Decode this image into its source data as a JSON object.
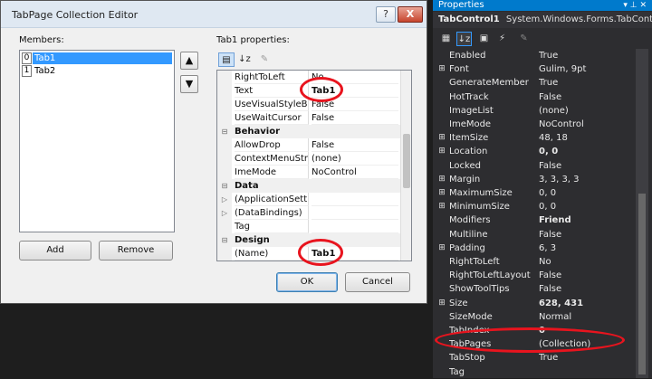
{
  "dialog": {
    "title": "TabPage Collection Editor",
    "help_label": "?",
    "close_label": "X",
    "members_label": "Members:",
    "members": [
      {
        "index": "0",
        "name": "Tab1",
        "selected": true
      },
      {
        "index": "1",
        "name": "Tab2",
        "selected": false
      }
    ],
    "up_label": "▲",
    "down_label": "▼",
    "add_label": "Add",
    "remove_label": "Remove",
    "props_label": "Tab1 properties:",
    "ok_label": "OK",
    "cancel_label": "Cancel",
    "grid_rows": [
      {
        "kind": "prop",
        "name": "RightToLeft",
        "value": "No"
      },
      {
        "kind": "prop",
        "name": "Text",
        "value": "Tab1"
      },
      {
        "kind": "prop",
        "name": "UseVisualStyleBack",
        "value": "False"
      },
      {
        "kind": "prop",
        "name": "UseWaitCursor",
        "value": "False"
      },
      {
        "kind": "cat",
        "name": "Behavior",
        "expander": "⊟"
      },
      {
        "kind": "prop",
        "name": "AllowDrop",
        "value": "False"
      },
      {
        "kind": "prop",
        "name": "ContextMenuStrip",
        "value": "(none)"
      },
      {
        "kind": "prop",
        "name": "ImeMode",
        "value": "NoControl"
      },
      {
        "kind": "cat",
        "name": "Data",
        "expander": "⊟"
      },
      {
        "kind": "prop",
        "name": "(ApplicationSetting",
        "value": "",
        "expander": "▷"
      },
      {
        "kind": "prop",
        "name": "(DataBindings)",
        "value": "",
        "expander": "▷"
      },
      {
        "kind": "prop",
        "name": "Tag",
        "value": ""
      },
      {
        "kind": "cat",
        "name": "Design",
        "expander": "⊟"
      },
      {
        "kind": "prop",
        "name": "(Name)",
        "value": "Tab1"
      }
    ]
  },
  "properties": {
    "title": "Properties",
    "pin_icons": "▾ ⊥ ✕",
    "object_name": "TabControl1",
    "object_type": "System.Windows.Forms.TabControl",
    "rows": [
      {
        "exp": "",
        "name": "Enabled",
        "value": "True",
        "bold": false
      },
      {
        "exp": "⊞",
        "name": "Font",
        "value": "Gulim, 9pt",
        "bold": false
      },
      {
        "exp": "",
        "name": "GenerateMember",
        "value": "True",
        "bold": false
      },
      {
        "exp": "",
        "name": "HotTrack",
        "value": "False",
        "bold": false
      },
      {
        "exp": "",
        "name": "ImageList",
        "value": "(none)",
        "bold": false
      },
      {
        "exp": "",
        "name": "ImeMode",
        "value": "NoControl",
        "bold": false
      },
      {
        "exp": "⊞",
        "name": "ItemSize",
        "value": "48, 18",
        "bold": false
      },
      {
        "exp": "⊞",
        "name": "Location",
        "value": "0, 0",
        "bold": true
      },
      {
        "exp": "",
        "name": "Locked",
        "value": "False",
        "bold": false
      },
      {
        "exp": "⊞",
        "name": "Margin",
        "value": "3, 3, 3, 3",
        "bold": false
      },
      {
        "exp": "⊞",
        "name": "MaximumSize",
        "value": "0, 0",
        "bold": false
      },
      {
        "exp": "⊞",
        "name": "MinimumSize",
        "value": "0, 0",
        "bold": false
      },
      {
        "exp": "",
        "name": "Modifiers",
        "value": "Friend",
        "bold": true
      },
      {
        "exp": "",
        "name": "Multiline",
        "value": "False",
        "bold": false
      },
      {
        "exp": "⊞",
        "name": "Padding",
        "value": "6, 3",
        "bold": false
      },
      {
        "exp": "",
        "name": "RightToLeft",
        "value": "No",
        "bold": false
      },
      {
        "exp": "",
        "name": "RightToLeftLayout",
        "value": "False",
        "bold": false
      },
      {
        "exp": "",
        "name": "ShowToolTips",
        "value": "False",
        "bold": false
      },
      {
        "exp": "⊞",
        "name": "Size",
        "value": "628, 431",
        "bold": true
      },
      {
        "exp": "",
        "name": "SizeMode",
        "value": "Normal",
        "bold": false
      },
      {
        "exp": "",
        "name": "TabIndex",
        "value": "0",
        "bold": true
      },
      {
        "exp": "",
        "name": "TabPages",
        "value": "(Collection)",
        "bold": false
      },
      {
        "exp": "",
        "name": "TabStop",
        "value": "True",
        "bold": false
      },
      {
        "exp": "",
        "name": "Tag",
        "value": "",
        "bold": false
      }
    ]
  },
  "colors": {
    "highlight": "#e8141e",
    "selection": "#3399ff",
    "title_bar": "#007acc"
  }
}
